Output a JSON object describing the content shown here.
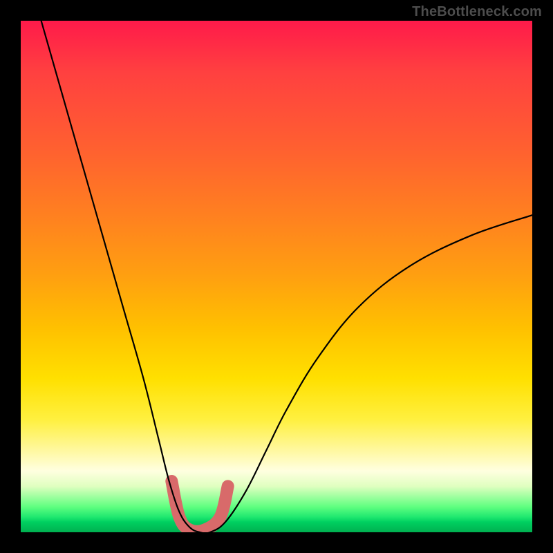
{
  "watermark": {
    "text": "TheBottleneck.com"
  },
  "chart_data": {
    "type": "line",
    "title": "",
    "xlabel": "",
    "ylabel": "",
    "xlim": [
      0,
      100
    ],
    "ylim": [
      0,
      100
    ],
    "gradient": {
      "orientation": "vertical",
      "stops": [
        {
          "pos": 0,
          "color": "#ff1a4a"
        },
        {
          "pos": 25,
          "color": "#ff6030"
        },
        {
          "pos": 50,
          "color": "#ffa010"
        },
        {
          "pos": 70,
          "color": "#ffe000"
        },
        {
          "pos": 88,
          "color": "#ffffe0"
        },
        {
          "pos": 95,
          "color": "#60ff80"
        },
        {
          "pos": 100,
          "color": "#00b050"
        }
      ]
    },
    "series": [
      {
        "name": "bottleneck-curve",
        "color": "#000000",
        "stroke_width": 2,
        "x": [
          4,
          8,
          12,
          16,
          20,
          24,
          27,
          29,
          31,
          33,
          35,
          37,
          40,
          44,
          48,
          52,
          58,
          66,
          76,
          88,
          100
        ],
        "y": [
          100,
          86,
          72,
          58,
          44,
          30,
          18,
          10,
          4,
          1,
          0,
          0,
          2,
          8,
          16,
          24,
          34,
          44,
          52,
          58,
          62
        ]
      }
    ],
    "annotations": [
      {
        "name": "valley-marker",
        "type": "path",
        "color": "#d86a6a",
        "stroke_width": 14,
        "points_x": [
          29.5,
          31,
          33,
          36,
          39,
          40.5
        ],
        "points_y": [
          10,
          3,
          0.5,
          0.5,
          3,
          9
        ]
      }
    ]
  }
}
